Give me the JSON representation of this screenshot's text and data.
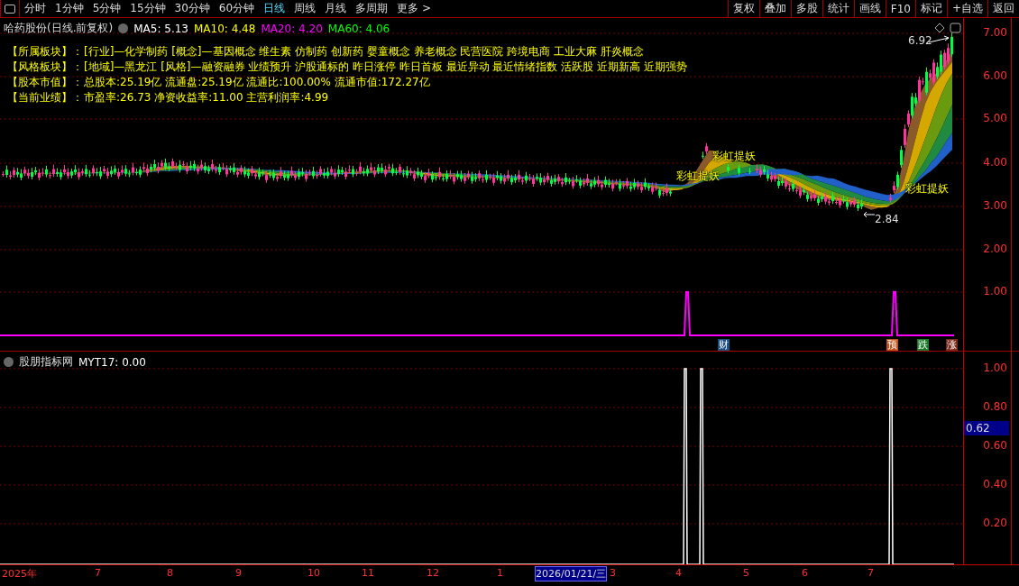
{
  "toolbar": {
    "periods": [
      {
        "label": "分时",
        "selected": false
      },
      {
        "label": "1分钟",
        "selected": false
      },
      {
        "label": "5分钟",
        "selected": false
      },
      {
        "label": "15分钟",
        "selected": false
      },
      {
        "label": "30分钟",
        "selected": false
      },
      {
        "label": "60分钟",
        "selected": false
      },
      {
        "label": "日线",
        "selected": true
      },
      {
        "label": "周线",
        "selected": false
      },
      {
        "label": "月线",
        "selected": false
      },
      {
        "label": "多周期",
        "selected": false
      }
    ],
    "more": "更多 >",
    "buttons": [
      "复权",
      "叠加",
      "多股",
      "统计",
      "画线",
      "F10",
      "标记",
      "+自选",
      "返回"
    ]
  },
  "stock_header": {
    "title": "哈药股份(日线.前复权)",
    "mas": [
      {
        "label": "MA5: 5.13",
        "color": "#ffffff"
      },
      {
        "label": "MA10: 4.48",
        "color": "#ffff00"
      },
      {
        "label": "MA20: 4.20",
        "color": "#ff00ff"
      },
      {
        "label": "MA60: 4.06",
        "color": "#00ff00"
      }
    ]
  },
  "info_rows": [
    {
      "label": "【所属板块】：",
      "value": "[行业]—化学制药 [概念]—基因概念 维生素 仿制药 创新药 婴童概念 养老概念 民营医院 跨境电商 工业大麻 肝炎概念"
    },
    {
      "label": "【风格板块】：",
      "value": "[地域]—黑龙江 [风格]—融资融券 业绩预升 沪股通标的 昨日涨停 昨日首板 最近异动 最近情绪指数 活跃股 近期新高 近期强势"
    },
    {
      "label": "【股本市值】：",
      "value": "总股本:25.19亿 流通盘:25.19亿 流通比:100.00% 流通市值:172.27亿"
    },
    {
      "label": "【当前业绩】：",
      "value": "市盈率:26.73 净资收益率:11.00 主营利润率:4.99"
    }
  ],
  "price_chart": {
    "high_label": "6.92",
    "low_label": "2.84",
    "signals": [
      "彩虹提妖",
      "彩虹提妖",
      "彩虹提妖"
    ],
    "y_ticks": [
      "7.00",
      "6.00",
      "5.00",
      "4.00",
      "3.00",
      "2.00",
      "1.00"
    ]
  },
  "event_markers": [
    {
      "label": "财",
      "color": "#1c4e80"
    },
    {
      "label": "预",
      "color": "#c0501a"
    },
    {
      "label": "跌",
      "color": "#1a7a2a"
    },
    {
      "label": "涨",
      "color": "#7a2a1a"
    }
  ],
  "indicator": {
    "title": "股朋指标网",
    "reading": "MYT17: 0.00",
    "y_ticks": [
      "1.00",
      "0.80",
      "0.60",
      "0.40",
      "0.20"
    ],
    "cursor_value": "0.62"
  },
  "time_axis": [
    {
      "label": "2025年",
      "selected": false
    },
    {
      "label": "7",
      "selected": false
    },
    {
      "label": "8",
      "selected": false
    },
    {
      "label": "9",
      "selected": false
    },
    {
      "label": "10",
      "selected": false
    },
    {
      "label": "11",
      "selected": false
    },
    {
      "label": "12",
      "selected": false
    },
    {
      "label": "1",
      "selected": false
    },
    {
      "label": "2026/01/21/三",
      "selected": true
    },
    {
      "label": "3",
      "selected": false
    },
    {
      "label": "4",
      "selected": false
    },
    {
      "label": "5",
      "selected": false
    },
    {
      "label": "6",
      "selected": false
    },
    {
      "label": "7",
      "selected": false
    }
  ]
}
